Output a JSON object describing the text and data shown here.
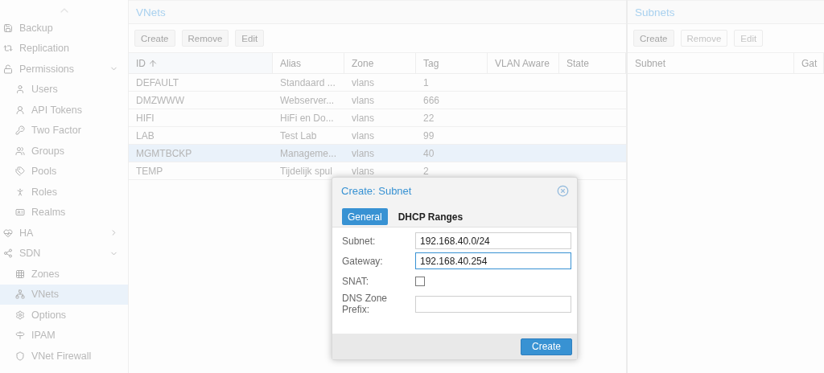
{
  "sidebar": {
    "items": [
      {
        "label": "Backup",
        "selected": false
      },
      {
        "label": "Replication",
        "selected": false
      },
      {
        "label": "Permissions",
        "selected": false,
        "expanded": true,
        "children": [
          {
            "label": "Users",
            "selected": false
          },
          {
            "label": "API Tokens",
            "selected": false
          },
          {
            "label": "Two Factor",
            "selected": false
          },
          {
            "label": "Groups",
            "selected": false
          },
          {
            "label": "Pools",
            "selected": false
          },
          {
            "label": "Roles",
            "selected": false
          },
          {
            "label": "Realms",
            "selected": false
          }
        ]
      },
      {
        "label": "HA",
        "selected": false,
        "expanded": false
      },
      {
        "label": "SDN",
        "selected": false,
        "expanded": true,
        "children": [
          {
            "label": "Zones",
            "selected": false
          },
          {
            "label": "VNets",
            "selected": true
          },
          {
            "label": "Options",
            "selected": false
          },
          {
            "label": "IPAM",
            "selected": false
          },
          {
            "label": "VNet Firewall",
            "selected": false
          }
        ]
      }
    ]
  },
  "vnets": {
    "title": "VNets",
    "buttons": [
      {
        "label": "Create",
        "disabled": false
      },
      {
        "label": "Remove",
        "disabled": false
      },
      {
        "label": "Edit",
        "disabled": false
      }
    ],
    "columns": [
      "ID",
      "Alias",
      "Zone",
      "Tag",
      "VLAN Aware",
      "State"
    ],
    "rows": [
      {
        "cells": [
          "DEFAULT",
          "Standaard ...",
          "vlans",
          "1"
        ],
        "selected": false
      },
      {
        "cells": [
          "DMZWWW",
          "Webserver...",
          "vlans",
          "666"
        ],
        "selected": false
      },
      {
        "cells": [
          "HIFI",
          "HiFi en Do...",
          "vlans",
          "22"
        ],
        "selected": false
      },
      {
        "cells": [
          "LAB",
          "Test Lab",
          "vlans",
          "99"
        ],
        "selected": false
      },
      {
        "cells": [
          "MGMTBCKP",
          "Manageme...",
          "vlans",
          "40"
        ],
        "selected": true
      },
      {
        "cells": [
          "TEMP",
          "Tijdelijk spul",
          "vlans",
          "2"
        ],
        "selected": false
      }
    ]
  },
  "subnets": {
    "title": "Subnets",
    "buttons": [
      {
        "label": "Create",
        "disabled": false
      },
      {
        "label": "Remove",
        "disabled": true
      },
      {
        "label": "Edit",
        "disabled": true
      }
    ],
    "columns": [
      "Subnet",
      "Gat"
    ]
  },
  "dialog": {
    "title": "Create: Subnet",
    "tabs": [
      {
        "label": "General",
        "selected": true
      },
      {
        "label": "DHCP Ranges",
        "selected": false
      }
    ],
    "fields": [
      {
        "kind": "text",
        "label": "Subnet:",
        "value": "192.168.40.0/24",
        "focused": false
      },
      {
        "kind": "text",
        "label": "Gateway:",
        "value": "192.168.40.254",
        "focused": true
      },
      {
        "kind": "checkbox",
        "label": "SNAT:",
        "checked": false
      },
      {
        "kind": "text",
        "label": "DNS Zone Prefix:",
        "focused": false
      }
    ],
    "submit": "Create"
  }
}
